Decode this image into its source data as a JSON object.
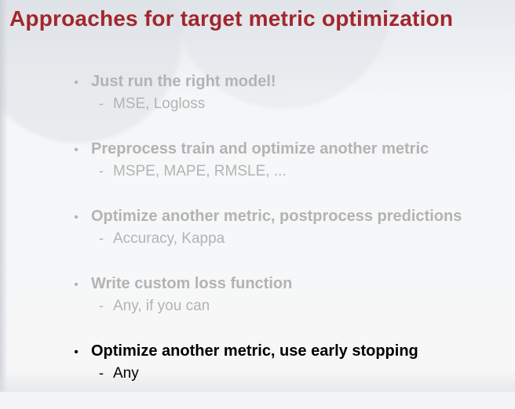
{
  "slide": {
    "title": "Approaches for target metric optimization",
    "items": [
      {
        "heading": "Just run the right model!",
        "detail": "MSE, Logloss",
        "state": "faded"
      },
      {
        "heading": "Preprocess train and optimize another metric",
        "detail": "MSPE, MAPE, RMSLE, ...",
        "state": "faded"
      },
      {
        "heading": "Optimize another metric, postprocess predictions",
        "detail": "Accuracy, Kappa",
        "state": "faded"
      },
      {
        "heading": "Write custom loss function",
        "detail": "Any, if you can",
        "state": "faded"
      },
      {
        "heading": "Optimize another metric, use early stopping",
        "detail": "Any",
        "state": "active"
      }
    ],
    "bullet_symbol": "•",
    "dash_symbol": "-",
    "colors": {
      "title": "#a3262d",
      "faded_text": "#b3b3b3",
      "active_text": "#000000"
    }
  }
}
